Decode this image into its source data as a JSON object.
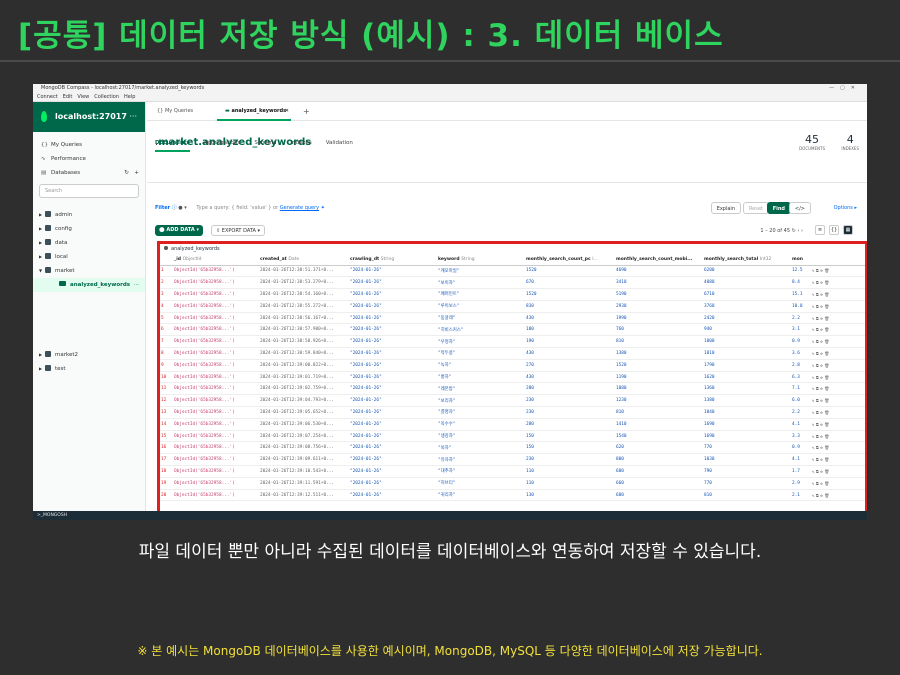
{
  "slide": {
    "title": "[공통] 데이터 저장 방식 (예시) : 3. 데이터 베이스",
    "caption": "파일 데이터 뿐만 아니라 수집된 데이터를 데이터베이스와 연동하여 저장할 수 있습니다.",
    "footnote": "※ 본 예시는 MongoDB 데이터베이스를 사용한 예시이며, MongoDB, MySQL 등 다양한 데이터베이스에 저장 가능합니다."
  },
  "window": {
    "title": "MongoDB Compass - localhost:27017/market.analyzed_keywords",
    "menu": [
      "Connect",
      "Edit",
      "View",
      "Collection",
      "Help"
    ]
  },
  "sidebar": {
    "connection": "localhost:27017",
    "items": [
      {
        "label": "My Queries",
        "icon": "braces-icon"
      },
      {
        "label": "Performance",
        "icon": "performance-icon"
      },
      {
        "label": "Databases",
        "icon": "database-icon"
      }
    ],
    "search_placeholder": "Search",
    "tree": [
      {
        "label": "admin"
      },
      {
        "label": "config"
      },
      {
        "label": "data"
      },
      {
        "label": "local"
      },
      {
        "label": "market"
      },
      {
        "label": "analyzed_keywords"
      },
      {
        "label": "market2"
      },
      {
        "label": "test"
      }
    ]
  },
  "tabs": [
    "My Queries",
    "analyzed_keywords"
  ],
  "collection": {
    "prefix": ".",
    "db": "market",
    "name": ".analyzed_keywords",
    "documents_count": "45",
    "documents_label": "DOCUMENTS",
    "indexes_count": "4",
    "indexes_label": "INDEXES",
    "subtabs": [
      "Documents",
      "Aggregations",
      "Schema",
      "Indexes",
      "Validation"
    ]
  },
  "filter": {
    "label": "Filter",
    "hint": "Type a query: { field: 'value' } or",
    "generate": "Generate query",
    "explain": "Explain",
    "reset": "Reset",
    "find": "Find",
    "options": "Options"
  },
  "toolbar": {
    "add_data": "ADD DATA",
    "export_data": "EXPORT DATA",
    "pager": "1 – 20 of 45"
  },
  "grid": {
    "label": "analyzed_keywords",
    "columns": [
      {
        "name": "_id",
        "type": "ObjectId"
      },
      {
        "name": "created_at",
        "type": "Date"
      },
      {
        "name": "crawling_dt",
        "type": "String"
      },
      {
        "name": "keyword",
        "type": "String"
      },
      {
        "name": "monthly_search_count_pc",
        "type": "I..."
      },
      {
        "name": "monthly_search_count_mobi...",
        "type": ""
      },
      {
        "name": "monthly_search_total",
        "type": "Int32"
      },
      {
        "name": "mon",
        "type": ""
      }
    ],
    "rows": [
      [
        "1",
        "ObjectId('65b32958...')",
        "2024-01-26T12:38:51.371+0...",
        "\"2024-01-26\"",
        "\"캐모마일\"",
        "1520",
        "4690",
        "6200",
        "12.5"
      ],
      [
        "2",
        "ObjectId('65b32958...')",
        "2024-01-26T12:38:53.279+0...",
        "\"2024-01-26\"",
        "\"보이차\"",
        "670",
        "3410",
        "4080",
        "8.4"
      ],
      [
        "3",
        "ObjectId('65b32958...')",
        "2024-01-26T12:38:54.160+0...",
        "\"2024-01-26\"",
        "\"페퍼민트\"",
        "1520",
        "5190",
        "6710",
        "15.1"
      ],
      [
        "4",
        "ObjectId('65b32958...')",
        "2024-01-26T12:38:55.272+0...",
        "\"2024-01-26\"",
        "\"루이보스\"",
        "830",
        "2930",
        "3760",
        "10.0"
      ],
      [
        "5",
        "ObjectId('65b32958...')",
        "2024-01-26T12:38:56.167+0...",
        "\"2024-01-26\"",
        "\"둥굴레\"",
        "430",
        "1990",
        "2420",
        "2.2"
      ],
      [
        "6",
        "ObjectId('65b32958...')",
        "2024-01-26T12:38:57.900+0...",
        "\"2024-01-26\"",
        "\"히비스커스\"",
        "180",
        "760",
        "940",
        "3.1"
      ],
      [
        "7",
        "ObjectId('65b32958...')",
        "2024-01-26T12:38:58.926+0...",
        "\"2024-01-26\"",
        "\"우엉차\"",
        "190",
        "810",
        "1000",
        "0.9"
      ],
      [
        "8",
        "ObjectId('65b32958...')",
        "2024-01-26T12:38:59.840+0...",
        "\"2024-01-26\"",
        "\"작두콩\"",
        "430",
        "1380",
        "1810",
        "3.6"
      ],
      [
        "9",
        "ObjectId('65b32958...')",
        "2024-01-26T12:39:00.822+0...",
        "\"2024-01-26\"",
        "\"녹차\"",
        "270",
        "1520",
        "1790",
        "2.8"
      ],
      [
        "10",
        "ObjectId('65b32958...')",
        "2024-01-26T12:39:01.719+0...",
        "\"2024-01-26\"",
        "\"홍차\"",
        "430",
        "1190",
        "1620",
        "6.3"
      ],
      [
        "11",
        "ObjectId('65b32958...')",
        "2024-01-26T12:39:02.759+0...",
        "\"2024-01-26\"",
        "\"레몬밤\"",
        "280",
        "1080",
        "1360",
        "7.1"
      ],
      [
        "12",
        "ObjectId('65b32958...')",
        "2024-01-26T12:39:04.793+0...",
        "\"2024-01-26\"",
        "\"보리차\"",
        "230",
        "1230",
        "1380",
        "6.0"
      ],
      [
        "13",
        "ObjectId('65b32958...')",
        "2024-01-26T12:39:05.652+0...",
        "\"2024-01-26\"",
        "\"결명자\"",
        "230",
        "810",
        "1040",
        "2.2"
      ],
      [
        "14",
        "ObjectId('65b32958...')",
        "2024-01-26T12:39:06.530+0...",
        "\"2024-01-26\"",
        "\"옥수수\"",
        "280",
        "1410",
        "1690",
        "4.1"
      ],
      [
        "15",
        "ObjectId('65b32958...')",
        "2024-01-26T12:39:07.254+0...",
        "\"2024-01-26\"",
        "\"생강차\"",
        "150",
        "1540",
        "1690",
        "3.3"
      ],
      [
        "16",
        "ObjectId('65b32958...')",
        "2024-01-26T12:39:08.756+0...",
        "\"2024-01-26\"",
        "\"쑥차\"",
        "150",
        "620",
        "770",
        "0.9"
      ],
      [
        "17",
        "ObjectId('65b32958...')",
        "2024-01-26T12:39:09.611+0...",
        "\"2024-01-26\"",
        "\"유자차\"",
        "230",
        "800",
        "1030",
        "4.1"
      ],
      [
        "18",
        "ObjectId('65b32958...')",
        "2024-01-26T12:39:10.543+0...",
        "\"2024-01-26\"",
        "\"대추차\"",
        "110",
        "680",
        "790",
        "1.7"
      ],
      [
        "19",
        "ObjectId('65b32958...')",
        "2024-01-26T12:39:11.591+0...",
        "\"2024-01-26\"",
        "\"허브티\"",
        "110",
        "660",
        "770",
        "2.9"
      ],
      [
        "20",
        "ObjectId('65b32958...')",
        "2024-01-26T12:39:12.511+0...",
        "\"2024-01-26\"",
        "\"귀리차\"",
        "130",
        "680",
        "810",
        "2.1"
      ]
    ]
  },
  "statusbar": ">_MONGOSH",
  "colors": {
    "accent": "#2fd45e",
    "mongo_green": "#00684a",
    "highlight": "#e02020",
    "footnote": "#f1e03a"
  }
}
